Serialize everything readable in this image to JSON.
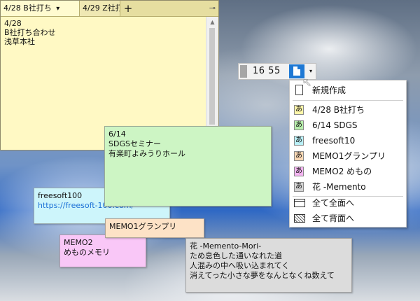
{
  "main_window": {
    "tabs": [
      {
        "label": "4/28  B社打ち",
        "dropdown": "▾"
      },
      {
        "label": "4/29  Z社打"
      }
    ],
    "add_tab_label": "+",
    "pin_label": "⊸",
    "content_lines": [
      "4/28",
      "B社打ち合わせ",
      "浅草本社"
    ],
    "scroll_up_glyph": "▲"
  },
  "notes": {
    "sdgs": {
      "lines": [
        "6/14",
        "SDGSセミナー",
        "有楽町よみうりホール"
      ],
      "color": "#cdf5c4"
    },
    "freesoft": {
      "lines": [
        "freesoft100",
        "https://freesoft-100.com/"
      ],
      "color": "#cdf5fb",
      "link_color": "#1a6fd6"
    },
    "memo1": {
      "lines": [
        "MEMO1グランプリ"
      ],
      "color": "#fde2c6"
    },
    "memo2": {
      "lines": [
        "MEMO2",
        "めものメモリ"
      ],
      "color": "#f9c7f7"
    },
    "memento": {
      "lines": [
        "花 -Memento-Mori-",
        "ため息色した通いなれた道",
        "人混みの中へ吸い込まれてく",
        "消えてった小さな夢をなんとなくね数えて"
      ],
      "color": "#dcdcdc"
    }
  },
  "time_widget": {
    "time": "16 55",
    "dropdown_glyph": "▾"
  },
  "menu": {
    "new_label": "新規作成",
    "items": [
      {
        "label": "4/28  B社打ち",
        "icon_text": "あ",
        "color": "#fff6a9"
      },
      {
        "label": "6/14  SDGS",
        "icon_text": "あ",
        "color": "#b9f0ad"
      },
      {
        "label": "freesoft10",
        "icon_text": "あ",
        "color": "#b9f0f7"
      },
      {
        "label": "MEMO1グランプリ",
        "icon_text": "あ",
        "color": "#fcd9b6"
      },
      {
        "label": "MEMO2  めもの",
        "icon_text": "あ",
        "color": "#f5b5f2"
      },
      {
        "label": "花 -Memento",
        "icon_text": "あ",
        "color": "#d4d4d4"
      }
    ],
    "all_front_label": "全て全面へ",
    "all_back_label": "全て背面へ"
  },
  "cursor_glyph": "↖"
}
